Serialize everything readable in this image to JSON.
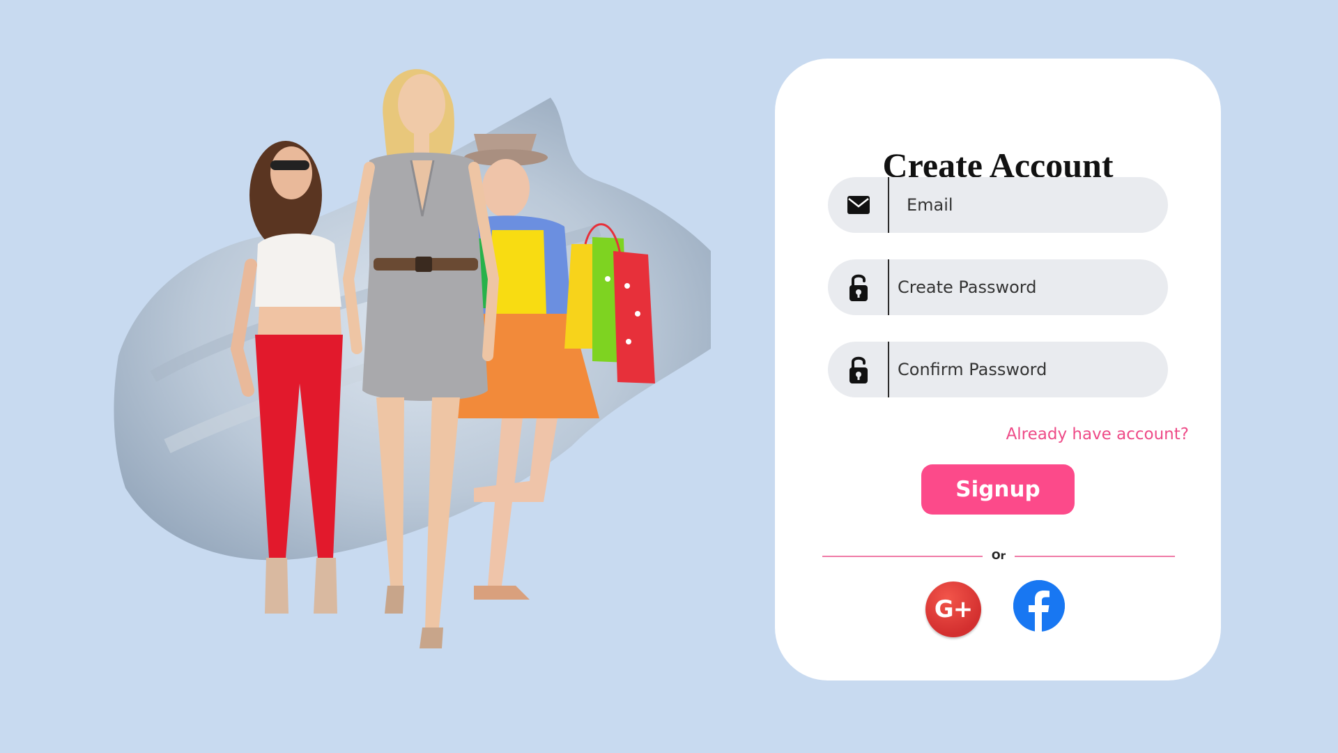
{
  "colors": {
    "background": "#c8daf0",
    "card": "#ffffff",
    "field": "#e9ebef",
    "accent": "#fc4a8a",
    "link": "#ee4a87",
    "google": "#e0342d",
    "facebook": "#1877f2"
  },
  "hero": {
    "image": "fashion-shoppers-illustration"
  },
  "form": {
    "title": "Create Account",
    "email_placeholder": "Email",
    "password_placeholder": "Create Password",
    "confirm_placeholder": "Confirm Password",
    "login_link": "Already have account?",
    "signup_label": "Signup",
    "divider_text": "Or"
  },
  "social": {
    "google_label": "G+",
    "google_icon": "google-plus-icon",
    "facebook_icon": "facebook-icon"
  },
  "icons": {
    "email": "envelope-icon",
    "password": "unlock-icon",
    "confirm": "unlock-icon"
  }
}
